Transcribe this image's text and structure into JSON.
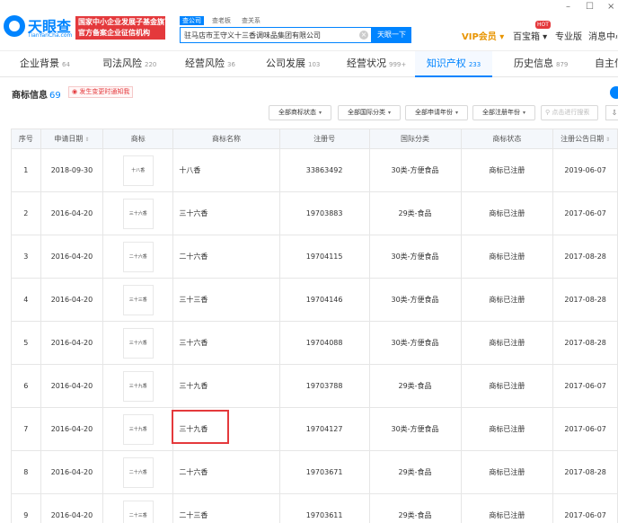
{
  "header": {
    "logo_name": "天眼查",
    "logo_domain": "TianYanCha.com",
    "promo_line1": "国家中小企业发展子基金旗下",
    "promo_line2": "官方备案企业征信机构",
    "search_tabs": [
      "查公司",
      "查老板",
      "查关系"
    ],
    "search_value": "驻马店市王守义十三香调味品集团有限公司",
    "search_button": "天眼一下",
    "vip_label": "VIP会员",
    "baike_label": "百宝箱",
    "hot_badge": "HOT",
    "pro_label": "专业版",
    "message_label": "消息中心",
    "win_minimize": "–",
    "win_maximize": "☐",
    "win_close": "×"
  },
  "nav": {
    "tabs": [
      {
        "label": "企业背景",
        "count": "64"
      },
      {
        "label": "司法风险",
        "count": "220"
      },
      {
        "label": "经营风险",
        "count": "36"
      },
      {
        "label": "公司发展",
        "count": "103"
      },
      {
        "label": "经营状况",
        "count": "999+"
      },
      {
        "label": "知识产权",
        "count": "233"
      },
      {
        "label": "历史信息",
        "count": "879"
      },
      {
        "label": "自主信息",
        "count": ""
      }
    ]
  },
  "section": {
    "title": "商标信息",
    "count": "69",
    "notice": "发生变更时通知我"
  },
  "filters": {
    "status": "全部商标状态",
    "category": "全部国际分类",
    "apply_year": "全部申请年份",
    "register_year": "全部注册年份",
    "search_placeholder": "点击进行搜索",
    "export_icon_glyph": "⇩"
  },
  "table": {
    "headers": [
      "序号",
      "申请日期",
      "商标",
      "商标名称",
      "注册号",
      "国际分类",
      "商标状态",
      "注册公告日期"
    ],
    "sort_glyph": "⇕",
    "rows": [
      {
        "index": "1",
        "apply_date": "2018-09-30",
        "logo_text": "十八香",
        "name": "十八香",
        "reg_no": "33863492",
        "category": "30类-方便食品",
        "status": "商标已注册",
        "pub_date": "2019-06-07"
      },
      {
        "index": "2",
        "apply_date": "2016-04-20",
        "logo_text": "三十六香",
        "name": "三十六香",
        "reg_no": "19703883",
        "category": "29类-食品",
        "status": "商标已注册",
        "pub_date": "2017-06-07"
      },
      {
        "index": "3",
        "apply_date": "2016-04-20",
        "logo_text": "二十六香",
        "name": "二十六香",
        "reg_no": "19704115",
        "category": "30类-方便食品",
        "status": "商标已注册",
        "pub_date": "2017-08-28"
      },
      {
        "index": "4",
        "apply_date": "2016-04-20",
        "logo_text": "三十三香",
        "name": "三十三香",
        "reg_no": "19704146",
        "category": "30类-方便食品",
        "status": "商标已注册",
        "pub_date": "2017-08-28"
      },
      {
        "index": "5",
        "apply_date": "2016-04-20",
        "logo_text": "三十六香",
        "name": "三十六香",
        "reg_no": "19704088",
        "category": "30类-方便食品",
        "status": "商标已注册",
        "pub_date": "2017-08-28"
      },
      {
        "index": "6",
        "apply_date": "2016-04-20",
        "logo_text": "三十九香",
        "name": "三十九香",
        "reg_no": "19703788",
        "category": "29类-食品",
        "status": "商标已注册",
        "pub_date": "2017-06-07"
      },
      {
        "index": "7",
        "apply_date": "2016-04-20",
        "logo_text": "三十九香",
        "name": "三十九香",
        "reg_no": "19704127",
        "category": "30类-方便食品",
        "status": "商标已注册",
        "pub_date": "2017-06-07"
      },
      {
        "index": "8",
        "apply_date": "2016-04-20",
        "logo_text": "二十六香",
        "name": "二十六香",
        "reg_no": "19703671",
        "category": "29类-食品",
        "status": "商标已注册",
        "pub_date": "2017-08-28"
      },
      {
        "index": "9",
        "apply_date": "2016-04-20",
        "logo_text": "二十三香",
        "name": "二十三香",
        "reg_no": "19703611",
        "category": "29类-食品",
        "status": "商标已注册",
        "pub_date": "2017-06-07"
      }
    ]
  },
  "colors": {
    "accent": "#0084ff",
    "promo_red": "#e4393c",
    "vip_gold": "#e89400",
    "highlight_border": "#e4393c"
  }
}
